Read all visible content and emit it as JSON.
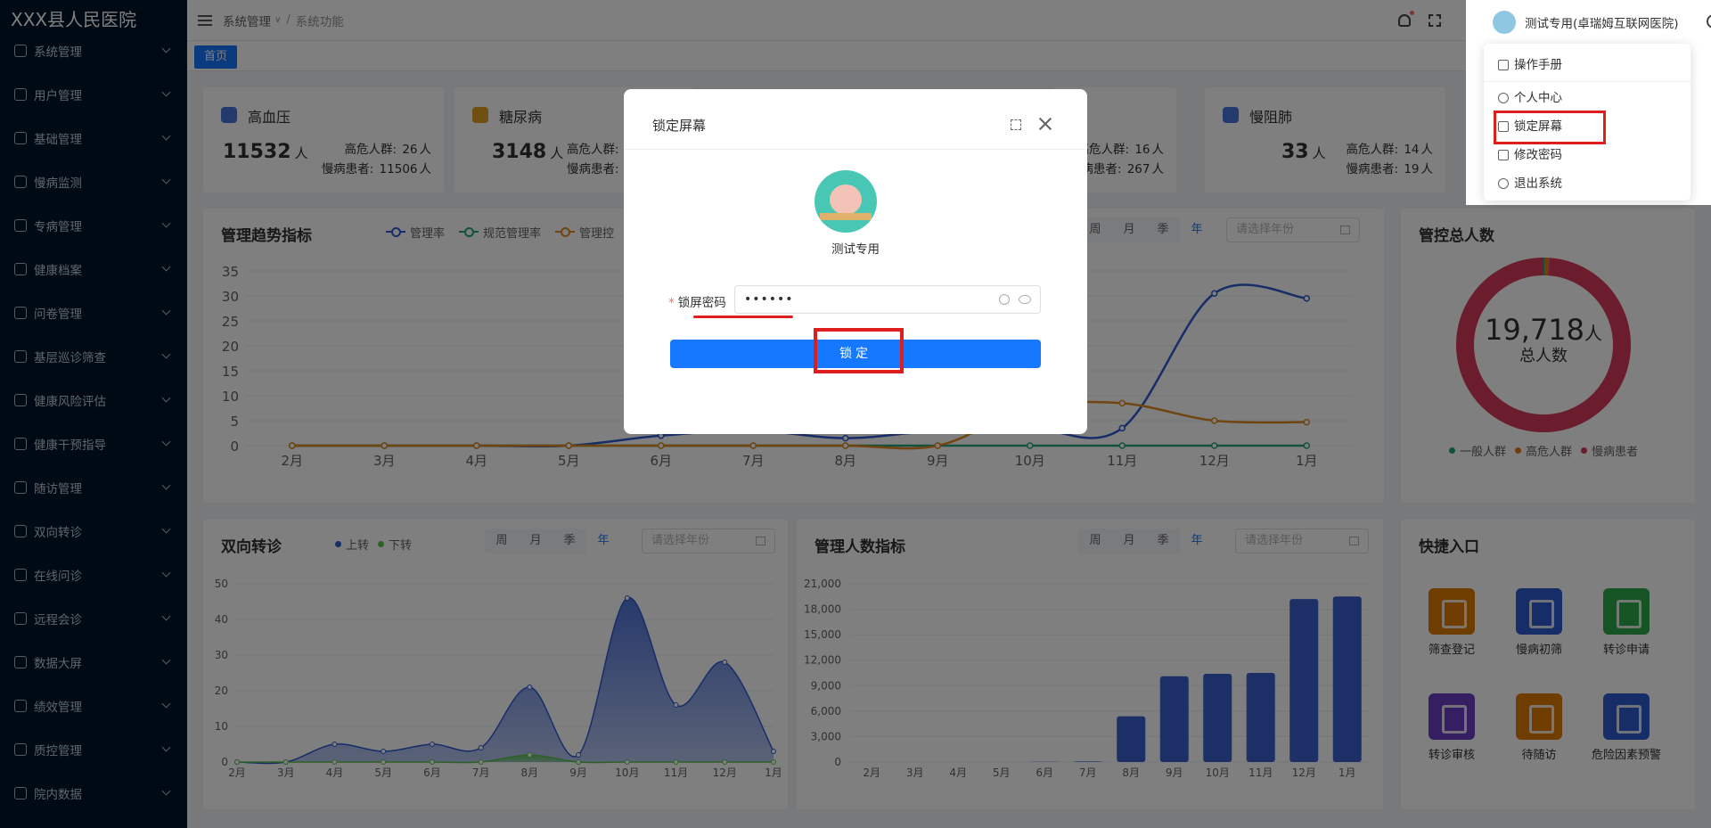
{
  "app": {
    "title": "XXX县人民医院"
  },
  "sidebar": {
    "items": [
      {
        "label": "系统管理"
      },
      {
        "label": "用户管理"
      },
      {
        "label": "基础管理"
      },
      {
        "label": "慢病监测"
      },
      {
        "label": "专病管理"
      },
      {
        "label": "健康档案"
      },
      {
        "label": "问卷管理"
      },
      {
        "label": "基层巡诊筛查"
      },
      {
        "label": "健康风险评估"
      },
      {
        "label": "健康干预指导"
      },
      {
        "label": "随访管理"
      },
      {
        "label": "双向转诊"
      },
      {
        "label": "在线问诊"
      },
      {
        "label": "远程会诊"
      },
      {
        "label": "数据大屏"
      },
      {
        "label": "绩效管理"
      },
      {
        "label": "质控管理"
      },
      {
        "label": "院内数据"
      }
    ]
  },
  "header": {
    "breadcrumb": [
      "系统管理",
      "系统功能"
    ],
    "user": "测试专用(卓瑞姆互联网医院)"
  },
  "tags": {
    "home": "首页"
  },
  "stats": [
    {
      "title": "高血压",
      "value": "11532",
      "unit": "人",
      "high_label": "高危人群:",
      "high": "26",
      "chronic_label": "慢病患者:",
      "chronic": "11506",
      "u": "人"
    },
    {
      "title": "糖尿病",
      "value": "3148",
      "unit": "人",
      "high_label": "高危人群:",
      "high": "",
      "chronic_label": "慢病患者:",
      "chronic": "",
      "u": ""
    },
    {
      "title": "",
      "value": "",
      "unit": "",
      "high_label": "高危人群:",
      "high": "16",
      "chronic_label": "慢病患者:",
      "chronic": "267",
      "u": "人"
    },
    {
      "title": "慢阻肺",
      "value": "33",
      "unit": "人",
      "high_label": "高危人群:",
      "high": "14",
      "chronic_label": "慢病患者:",
      "chronic": "19",
      "u": "人"
    }
  ],
  "trend": {
    "title": "管理趋势指标",
    "legend": [
      {
        "name": "管理率",
        "color": "#2f5bd1"
      },
      {
        "name": "规范管理率",
        "color": "#28a37a"
      },
      {
        "name": "管理控",
        "color": "#e08a1e"
      }
    ],
    "periods": [
      "周",
      "月",
      "季",
      "年"
    ],
    "active_period": "年",
    "year_placeholder": "请选择年份"
  },
  "total": {
    "title": "管控总人数",
    "value": "19,718",
    "unit": "人",
    "sub": "总人数",
    "legend": [
      {
        "name": "一般人群",
        "color": "#28a37a"
      },
      {
        "name": "高危人群",
        "color": "#e07a1e"
      },
      {
        "name": "慢病患者",
        "color": "#d63a5a"
      }
    ]
  },
  "referral": {
    "title": "双向转诊",
    "legend": [
      {
        "name": "上转",
        "color": "#2f5bd1"
      },
      {
        "name": "下转",
        "color": "#5bc24b"
      }
    ],
    "periods": [
      "周",
      "月",
      "季",
      "年"
    ],
    "active_period": "年",
    "year_placeholder": "请选择年份"
  },
  "mgmt": {
    "title": "管理人数指标",
    "periods": [
      "周",
      "月",
      "季",
      "年"
    ],
    "active_period": "年",
    "year_placeholder": "请选择年份"
  },
  "shortcuts": {
    "title": "快捷入口",
    "items": [
      {
        "label": "筛查登记",
        "color": "#e07a00"
      },
      {
        "label": "慢病初筛",
        "color": "#2f5bd1"
      },
      {
        "label": "转诊申请",
        "color": "#2ea84a"
      },
      {
        "label": "转诊审核",
        "color": "#6a3fc4"
      },
      {
        "label": "待随访",
        "color": "#e07a00"
      },
      {
        "label": "危险因素预警",
        "color": "#2f5bd1"
      }
    ]
  },
  "chart_data": [
    {
      "type": "line",
      "title": "管理趋势指标",
      "categories": [
        "2月",
        "3月",
        "4月",
        "5月",
        "6月",
        "7月",
        "8月",
        "9月",
        "10月",
        "11月",
        "12月",
        "1月"
      ],
      "ylim": [
        0,
        35
      ],
      "yticks": [
        0,
        5,
        10,
        15,
        20,
        25,
        30,
        35
      ],
      "series": [
        {
          "name": "管理率",
          "color": "#2f5bd1",
          "values": [
            0,
            0,
            0,
            0,
            2,
            3,
            1.5,
            3,
            3.5,
            3.5,
            30.5,
            29.5
          ]
        },
        {
          "name": "规范管理率",
          "color": "#28a37a",
          "values": [
            0,
            0,
            0,
            0,
            0,
            0,
            0,
            0,
            0,
            0,
            0,
            0
          ]
        },
        {
          "name": "管理控",
          "color": "#e08a1e",
          "values": [
            0,
            0,
            0,
            0,
            0,
            0,
            0,
            0,
            7.5,
            8.5,
            5,
            4.7
          ]
        }
      ]
    },
    {
      "type": "pie",
      "title": "管控总人数",
      "labels": [
        "一般人群",
        "高危人群",
        "慢病患者"
      ],
      "values": [
        60,
        152,
        19506
      ],
      "colors": [
        "#28a37a",
        "#e07a1e",
        "#d63a5a"
      ]
    },
    {
      "type": "area",
      "title": "双向转诊",
      "categories": [
        "2月",
        "3月",
        "4月",
        "5月",
        "6月",
        "7月",
        "8月",
        "9月",
        "10月",
        "11月",
        "12月",
        "1月"
      ],
      "ylim": [
        0,
        50
      ],
      "yticks": [
        0,
        10,
        20,
        30,
        40,
        50
      ],
      "series": [
        {
          "name": "上转",
          "color": "#2f5bd1",
          "values": [
            0,
            0,
            5,
            3,
            5,
            4,
            21,
            2,
            46,
            16,
            28,
            3
          ]
        },
        {
          "name": "下转",
          "color": "#5bc24b",
          "values": [
            0,
            0,
            0,
            0,
            0,
            0,
            2,
            0,
            0,
            0,
            0,
            0
          ]
        }
      ]
    },
    {
      "type": "bar",
      "title": "管理人数指标",
      "categories": [
        "2月",
        "3月",
        "4月",
        "5月",
        "6月",
        "7月",
        "8月",
        "9月",
        "10月",
        "11月",
        "12月",
        "1月"
      ],
      "ylim": [
        0,
        21000
      ],
      "yticks": [
        "0",
        "3,000",
        "6,000",
        "9,000",
        "12,000",
        "15,000",
        "18,000",
        "21,000"
      ],
      "values": [
        0,
        0,
        0,
        0,
        20,
        60,
        5400,
        10100,
        10400,
        10500,
        19200,
        19500
      ],
      "color": "#3b5fcf"
    }
  ],
  "modal": {
    "title": "锁定屏幕",
    "username": "测试专用",
    "field_label": "锁屏密码",
    "password": "••••••",
    "button": "锁定"
  },
  "dropdown": {
    "items": [
      "操作手册",
      "个人中心",
      "锁定屏幕",
      "修改密码",
      "退出系统"
    ]
  }
}
